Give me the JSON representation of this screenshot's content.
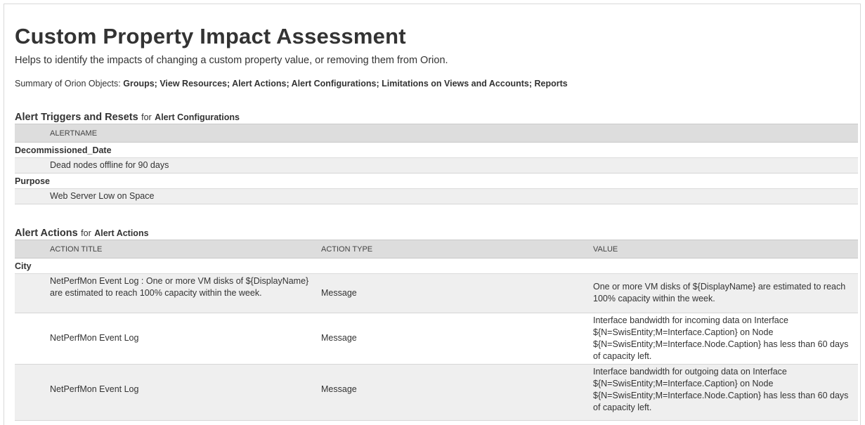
{
  "page": {
    "title": "Custom Property Impact Assessment",
    "subtitle": "Helps to identify the impacts of changing a custom property value, or removing them from Orion.",
    "summary_label": "Summary of Orion Objects:",
    "summary_objects": "Groups; View Resources; Alert Actions; Alert Configurations; Limitations on Views and Accounts; Reports"
  },
  "alert_triggers": {
    "title": "Alert Triggers and Resets",
    "for_word": "for",
    "object": "Alert Configurations",
    "columns": [
      "ALERTNAME"
    ],
    "groups": [
      {
        "name": "Decommissioned_Date",
        "rows": [
          {
            "alertname": "Dead nodes offline for 90 days"
          }
        ]
      },
      {
        "name": "Purpose",
        "rows": [
          {
            "alertname": "Web Server Low on Space"
          }
        ]
      }
    ]
  },
  "alert_actions": {
    "title": "Alert Actions",
    "for_word": "for",
    "object": "Alert Actions",
    "columns": [
      "ACTION TITLE",
      "ACTION TYPE",
      "VALUE"
    ],
    "groups": [
      {
        "name": "City",
        "rows": [
          {
            "title": "NetPerfMon Event Log : One or more VM disks of ${DisplayName} are estimated to reach 100% capacity within the week.",
            "type": "Message",
            "value": "One or more VM disks of ${DisplayName} are estimated to reach 100% capacity within the week."
          },
          {
            "title": "NetPerfMon Event Log",
            "type": "Message",
            "value": "Interface bandwidth for incoming data on Interface ${N=SwisEntity;M=Interface.Caption} on Node ${N=SwisEntity;M=Interface.Node.Caption} has less than 60 days of capacity left."
          },
          {
            "title": "NetPerfMon Event Log",
            "type": "Message",
            "value": "Interface bandwidth for outgoing data on Interface ${N=SwisEntity;M=Interface.Caption} on Node ${N=SwisEntity;M=Interface.Node.Caption} has less than 60 days of capacity left."
          }
        ]
      }
    ]
  }
}
